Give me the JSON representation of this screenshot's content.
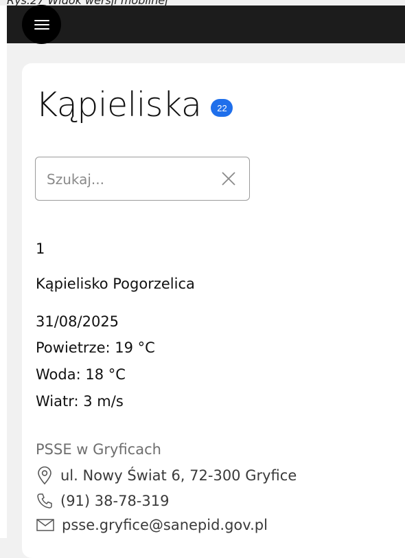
{
  "caption": "Rys.27 Widok wersji mobilnej",
  "header": {
    "menu_icon": "hamburger-menu-icon"
  },
  "page": {
    "title": "Kąpieliska",
    "count_badge": "22"
  },
  "search": {
    "placeholder": "Szukaj...",
    "value": "",
    "clear_icon": "close-icon"
  },
  "item": {
    "number": "1",
    "name": "Kąpielisko Pogorzelica",
    "date": "31/08/2025",
    "air": "Powietrze: 19 °C",
    "water": "Woda: 18 °C",
    "wind": "Wiatr: 3 m/s",
    "authority": "PSSE w Gryficach",
    "address": "ul. Nowy Świat 6, 72-300 Gryfice",
    "phone": "(91) 38-78-319",
    "email": "psse.gryfice@sanepid.gov.pl"
  },
  "colors": {
    "badge": "#1f6feb",
    "topbar": "#1c1c1c"
  }
}
